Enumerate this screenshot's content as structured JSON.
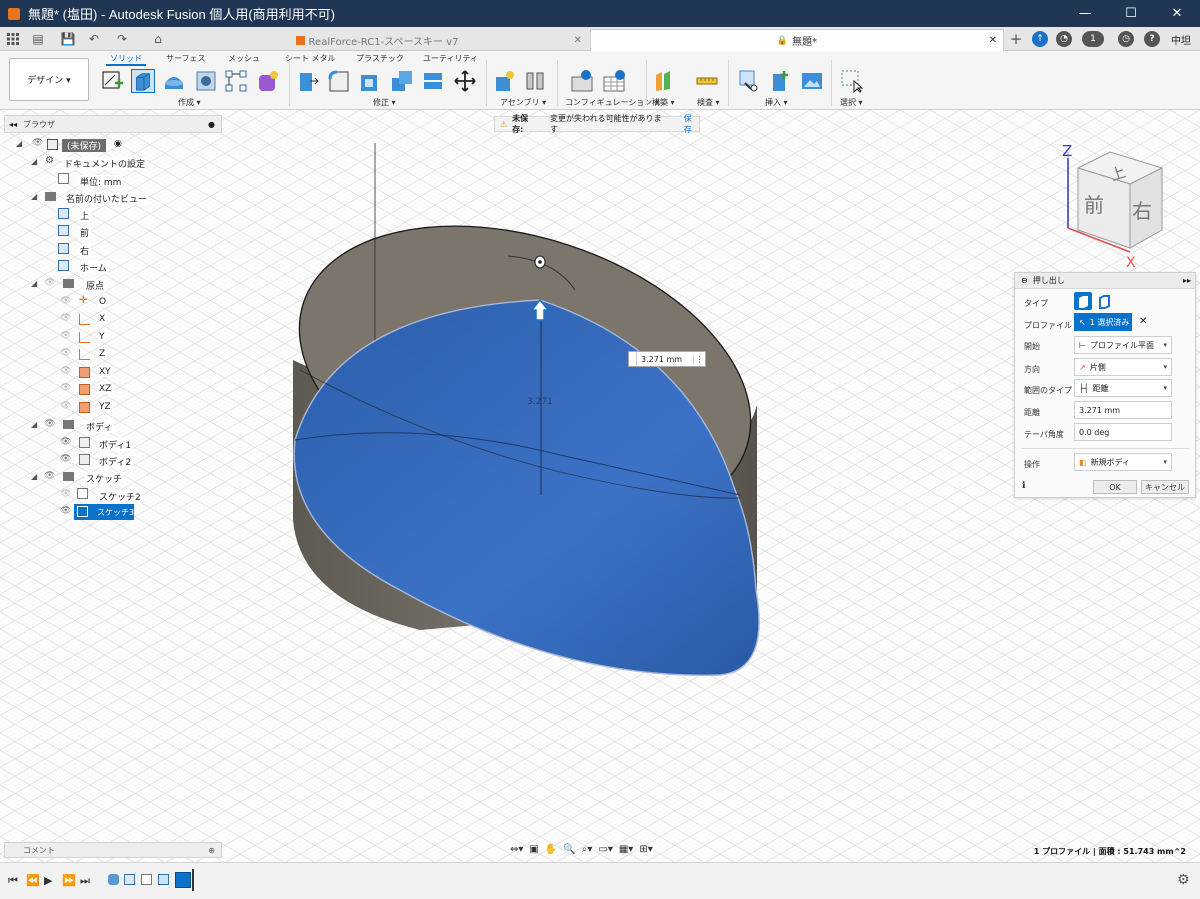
{
  "window": {
    "title": "無題* (塩田) - Autodesk Fusion 個人用(商用利用不可)",
    "controls": [
      "—",
      "☐",
      "✕"
    ]
  },
  "tabs": {
    "tab1": "RealForce-RC1-スペースキー v7",
    "tab2": "無題*",
    "notification_count": "1",
    "help": "?",
    "user": "中坦"
  },
  "ribbon": {
    "tabs": [
      "ソリッド",
      "サーフェス",
      "メッシュ",
      "シート メタル",
      "プラスチック",
      "ユーティリティ"
    ],
    "design": "デザイン ▾",
    "groups": [
      "作成 ▾",
      "修正 ▾",
      "アセンブリ ▾",
      "コンフィギュレーション ▾",
      "構築 ▾",
      "検査 ▾",
      "挿入 ▾",
      "選択 ▾"
    ]
  },
  "browser": {
    "title": "ブラウザ",
    "root": "(未保存)",
    "doc_settings": "ドキュメントの設定",
    "units": "単位: mm",
    "named_views": "名前の付いたビュー",
    "views": [
      "上",
      "前",
      "右",
      "ホーム"
    ],
    "origin": "原点",
    "origin_items": [
      "O",
      "X",
      "Y",
      "Z",
      "XY",
      "XZ",
      "YZ"
    ],
    "bodies": "ボディ",
    "body_items": [
      "ボディ1",
      "ボディ2"
    ],
    "sketches": "スケッチ",
    "sketch_items": [
      "スケッチ2",
      "スケッチ3"
    ]
  },
  "warning": {
    "label": "未保存:",
    "message": "変更が失われる可能性があります",
    "save": "保存"
  },
  "viewcube": {
    "top": "上",
    "front": "前",
    "right": "右",
    "z": "Z",
    "x": "X"
  },
  "extrude": {
    "title": "押し出し",
    "type_label": "タイプ",
    "profile_label": "プロファイル",
    "profile_value": "1 選択済み",
    "start_label": "開始",
    "start_value": "プロファイル平面",
    "direction_label": "方向",
    "direction_value": "片側",
    "extent_label": "範囲のタイプ",
    "extent_value": "距離",
    "distance_label": "距離",
    "distance_value": "3.271 mm",
    "taper_label": "テーパ角度",
    "taper_value": "0.0 deg",
    "operation_label": "操作",
    "operation_value": "新規ボディ",
    "ok": "OK",
    "cancel": "キャンセル"
  },
  "canvas": {
    "dim_input": "3.271 mm",
    "dim_label": "3.271"
  },
  "comment": "コメント",
  "status": "1 プロファイル | 面積 : 51.743 mm^2",
  "colors": {
    "titlebar": "#1f3654",
    "accent": "#0a72c8",
    "extrude_blue": "#2f68b8",
    "body_gray": "#6e6960"
  }
}
